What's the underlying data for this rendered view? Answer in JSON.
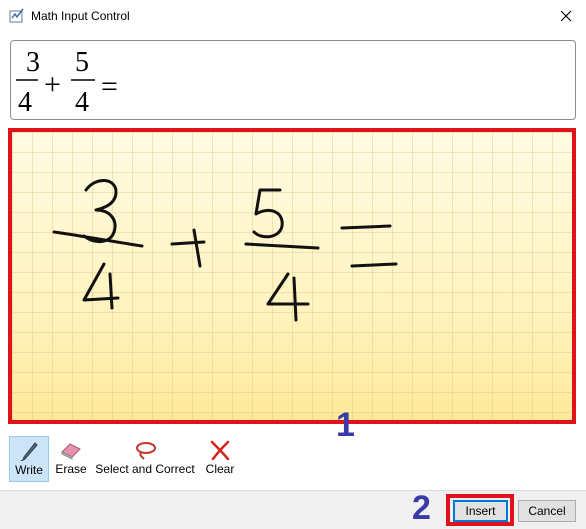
{
  "window": {
    "title": "Math Input Control",
    "icon": "math-input-icon",
    "close_icon": "close-icon"
  },
  "preview": {
    "fraction1": {
      "numerator": "3",
      "denominator": "4"
    },
    "operator": "+",
    "fraction2": {
      "numerator": "5",
      "denominator": "4"
    },
    "equals": "="
  },
  "canvas": {
    "handwriting": "3/4 + 5/4 ="
  },
  "markers": {
    "one": "1",
    "two": "2"
  },
  "toolbar": {
    "items": [
      {
        "label": "Write",
        "icon": "pen-icon",
        "selected": true
      },
      {
        "label": "Erase",
        "icon": "eraser-icon",
        "selected": false
      },
      {
        "label": "Select and Correct",
        "icon": "lasso-icon",
        "selected": false
      },
      {
        "label": "Clear",
        "icon": "clear-x-icon",
        "selected": false
      }
    ]
  },
  "buttons": {
    "insert": "Insert",
    "cancel": "Cancel"
  },
  "colors": {
    "highlight": "#e0121a",
    "marker": "#3a3aa8",
    "selected_tool": "#cce4f7",
    "canvas": "#fff7cc"
  }
}
